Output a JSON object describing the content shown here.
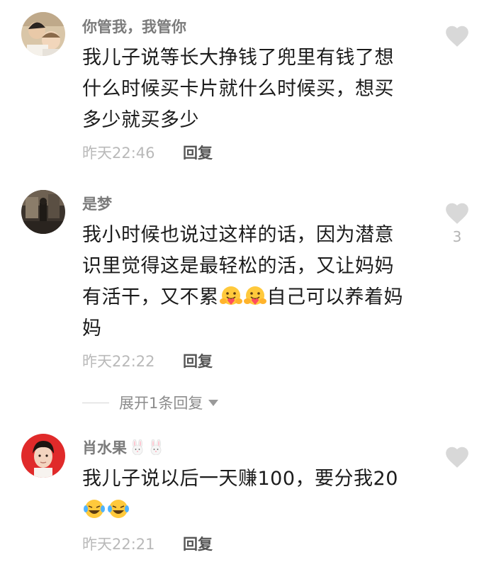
{
  "comments": [
    {
      "username": "你管我，我管你",
      "lines": [
        "我儿子说等长大挣钱了兜里有钱了想",
        "什么时候买卡片就什么时候买，想买",
        "多少就买多少"
      ],
      "time": "昨天22:46",
      "reply_label": "回复",
      "likes": ""
    },
    {
      "username": "是梦",
      "line1": "我小时候也说过这样的话，因为潜意",
      "line2": "识里觉得这是最轻松的活，又让妈妈",
      "line3_a": "有活干，又不累",
      "line3_b": "自己可以养着妈",
      "line4": "妈",
      "time": "昨天22:22",
      "reply_label": "回复",
      "likes": "3",
      "expand_label": "展开1条回复"
    },
    {
      "username": "肖水果",
      "line1": "我儿子说以后一天赚100，要分我20",
      "time": "昨天22:21",
      "reply_label": "回复",
      "likes": ""
    }
  ],
  "icons": {
    "like": "heart-icon",
    "emoji_hug": "hugging-face-emoji",
    "emoji_laugh": "tears-of-joy-emoji",
    "bunny": "rabbit-face-emoji",
    "expand": "caret-down-icon"
  },
  "colors": {
    "username": "#7b7b7b",
    "text": "#1b1b1b",
    "meta": "#b9b9b9",
    "heart": "#d8d8d8"
  }
}
